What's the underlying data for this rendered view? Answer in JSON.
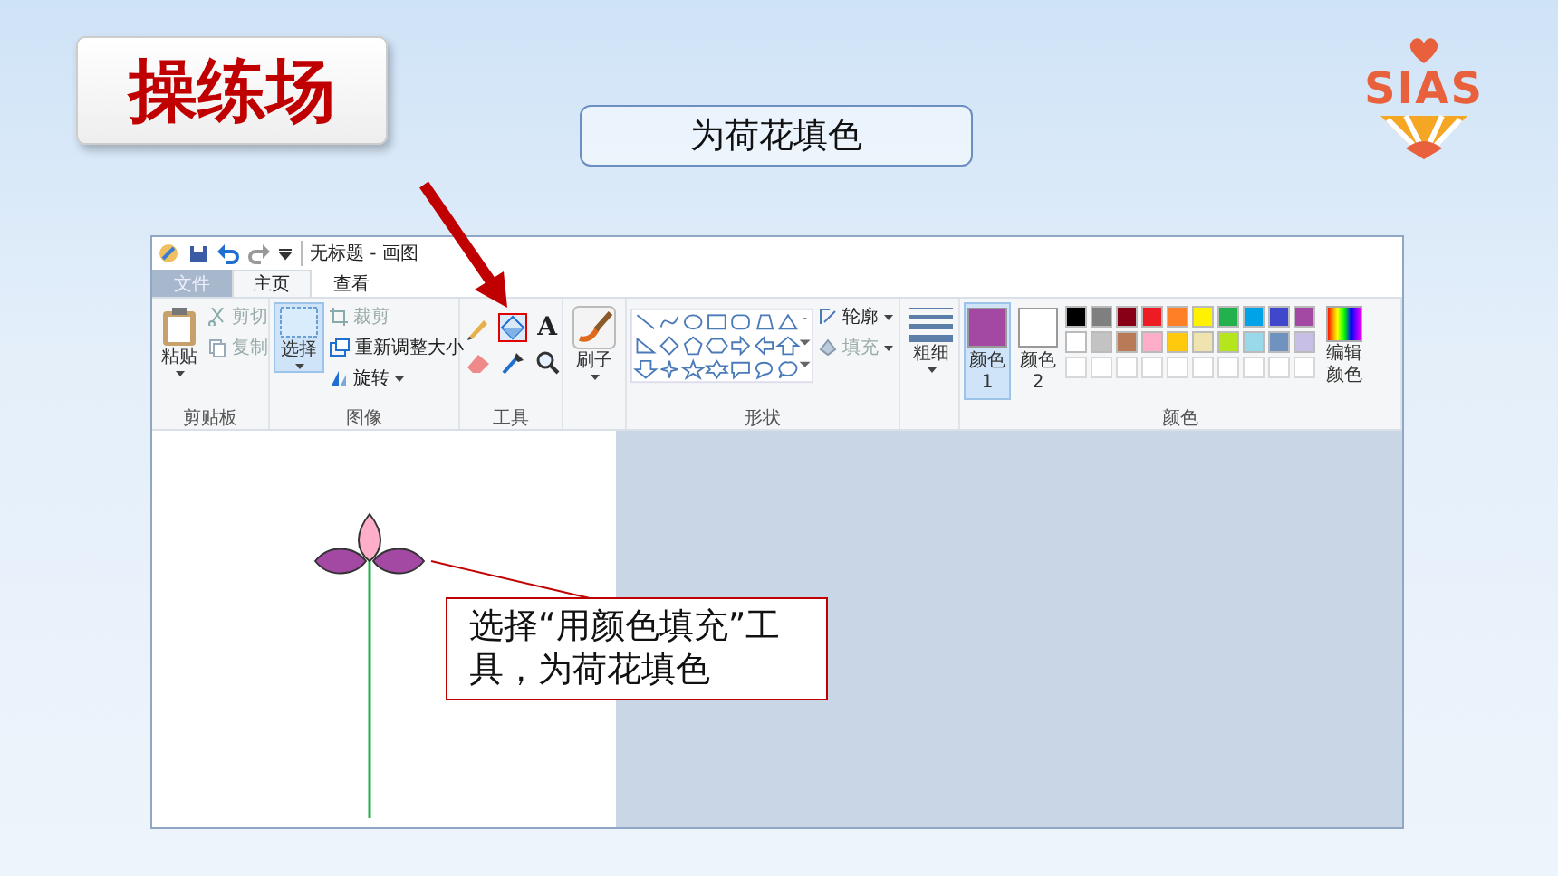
{
  "slide_title": "操练场",
  "subtitle": "为荷花填色",
  "logo": {
    "text": "SIAS"
  },
  "paint_window": {
    "title": "无标题 - 画图",
    "tabs": [
      {
        "label": "文件",
        "kind": "file",
        "selected": false
      },
      {
        "label": "主页",
        "kind": "tab",
        "selected": true
      },
      {
        "label": "查看",
        "kind": "tab",
        "selected": false
      }
    ],
    "clipboard": {
      "label": "剪贴板",
      "paste": "粘贴",
      "cut": {
        "label": "剪切",
        "disabled": true
      },
      "copy": {
        "label": "复制",
        "disabled": true
      }
    },
    "image": {
      "label": "图像",
      "select": "选择",
      "crop": {
        "label": "裁剪",
        "disabled": true
      },
      "resize": {
        "label": "重新调整大小",
        "disabled": false
      },
      "rotate": {
        "label": "旋转",
        "disabled": false
      }
    },
    "tools": {
      "label": "工具",
      "items": [
        {
          "kind": "pencil",
          "selected": false
        },
        {
          "kind": "fill",
          "selected": true
        },
        {
          "kind": "text",
          "glyph": "A",
          "selected": false
        },
        {
          "kind": "eraser",
          "selected": false
        },
        {
          "kind": "picker",
          "selected": false
        },
        {
          "kind": "magnifier",
          "selected": false
        }
      ]
    },
    "brushes": "刷子",
    "shapes": {
      "label": "形状",
      "outline": {
        "label": "轮廓",
        "disabled": false
      },
      "fill": {
        "label": "填充",
        "disabled": true
      }
    },
    "size": "粗细",
    "colors": {
      "label": "颜色",
      "color_1": {
        "label": "颜色 1",
        "color": "#a349a4",
        "selected": true
      },
      "color_2": {
        "label": "颜色 2",
        "color": "#ffffff",
        "selected": false
      },
      "palette": [
        {
          "kind": "swatch",
          "color": "#000000"
        },
        {
          "kind": "swatch",
          "color": "#7f7f7f"
        },
        {
          "kind": "swatch",
          "color": "#880015"
        },
        {
          "kind": "swatch",
          "color": "#ed1c24"
        },
        {
          "kind": "swatch",
          "color": "#ff7f27"
        },
        {
          "kind": "swatch",
          "color": "#fff200"
        },
        {
          "kind": "swatch",
          "color": "#22b14c"
        },
        {
          "kind": "swatch",
          "color": "#00a2e8"
        },
        {
          "kind": "swatch",
          "color": "#3f48cc"
        },
        {
          "kind": "swatch",
          "color": "#a349a4"
        },
        {
          "kind": "swatch",
          "color": "#ffffff"
        },
        {
          "kind": "swatch",
          "color": "#c3c3c3"
        },
        {
          "kind": "swatch",
          "color": "#b97a57"
        },
        {
          "kind": "swatch",
          "color": "#ffaec9"
        },
        {
          "kind": "swatch",
          "color": "#ffc90e"
        },
        {
          "kind": "swatch",
          "color": "#efe4b0"
        },
        {
          "kind": "swatch",
          "color": "#b5e61d"
        },
        {
          "kind": "swatch",
          "color": "#99d9ea"
        },
        {
          "kind": "swatch",
          "color": "#7092be"
        },
        {
          "kind": "swatch",
          "color": "#c8bfe7"
        },
        {
          "kind": "empty"
        },
        {
          "kind": "empty"
        },
        {
          "kind": "empty"
        },
        {
          "kind": "empty"
        },
        {
          "kind": "empty"
        },
        {
          "kind": "empty"
        },
        {
          "kind": "empty"
        },
        {
          "kind": "empty"
        },
        {
          "kind": "empty"
        },
        {
          "kind": "empty"
        }
      ],
      "edit": "编辑颜色"
    }
  },
  "callout": "选择“用颜色填充”工具，为荷花填色"
}
